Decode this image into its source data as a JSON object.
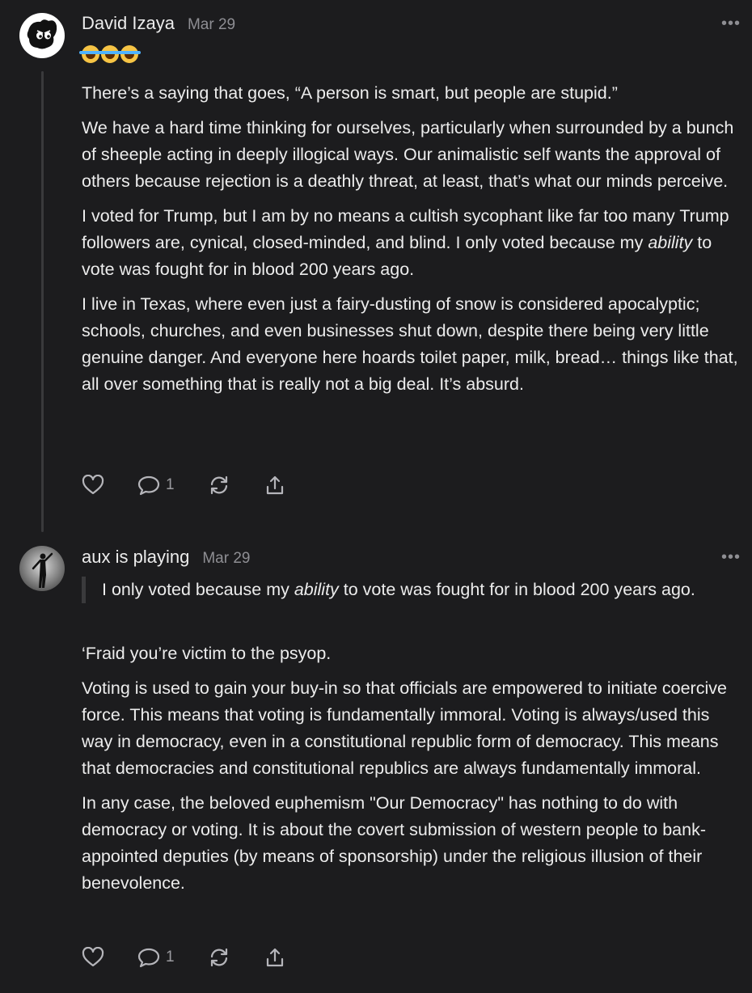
{
  "posts": [
    {
      "author": "David Izaya",
      "date": "Mar 29",
      "more": "•••",
      "paragraphs": [
        "There’s a saying that goes, “A person is smart, but people are stupid.”",
        "We have a hard time thinking for ourselves, particularly when surrounded by a bunch of sheeple acting in deeply illogical ways. Our animalistic self wants the approval of others because rejection is a deathly threat, at least, that’s what our minds perceive."
      ],
      "p3_before": "I voted for Trump, but I am by no means a cultish sycophant like far too many Trump followers are, cynical, closed-minded, and blind. I only voted because my ",
      "p3_em": "ability",
      "p3_after": " to vote was fought for in blood 200 years ago.",
      "p4": "I live in Texas, where even just a fairy-dusting of snow is considered apocalyptic; schools, churches, and even businesses shut down, despite there being very little genuine danger. And everyone here hoards toilet paper, milk, bread… things like that, all over something that is really not a big deal. It’s absurd.",
      "reply_count": "1"
    },
    {
      "author": "aux is playing",
      "date": "Mar 29",
      "more": "•••",
      "quote_before": "I only voted because my ",
      "quote_em": "ability",
      "quote_after": " to vote was fought for in blood 200 years ago.",
      "paragraphs": [
        "‘Fraid you’re victim to the psyop.",
        "Voting is used to gain your buy-in so that officials are empowered to initiate coercive force. This means that voting is fundamentally immoral. Voting is always/used this way in democracy, even in a constitutional republic form of democracy. This means that democracies and constitutional republics are always fundamentally immoral.",
        "In any case, the beloved euphemism \"Our Democracy\" has nothing to do with democracy or voting. It is about the covert submission of western people to bank-appointed deputies (by means of sponsorship) under the religious illusion of their benevolence."
      ],
      "reply_count": "1"
    }
  ],
  "icons": [
    "heart-icon",
    "comment-icon",
    "restack-icon",
    "share-icon",
    "more-icon"
  ],
  "colors": {
    "background": "#1c1c1e",
    "text": "#ececec",
    "muted": "#8e8e93"
  }
}
